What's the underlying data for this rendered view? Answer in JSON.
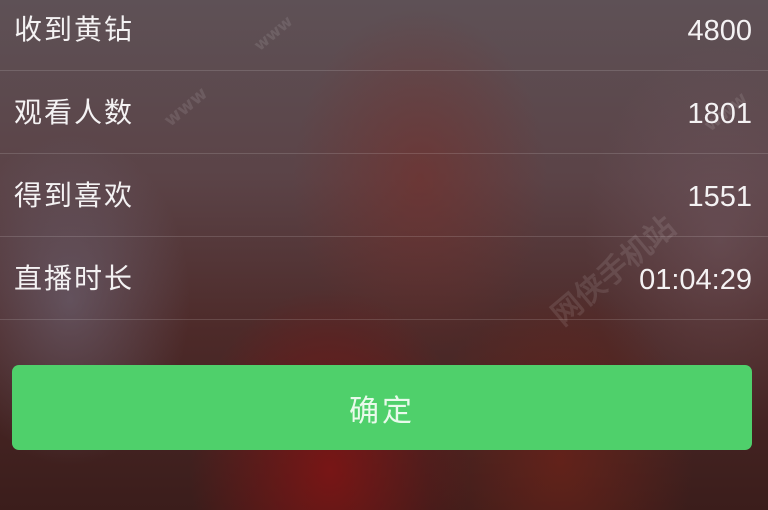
{
  "stats": {
    "rows": [
      {
        "label": "收到黄钻",
        "value": "4800"
      },
      {
        "label": "观看人数",
        "value": "1801"
      },
      {
        "label": "得到喜欢",
        "value": "1551"
      },
      {
        "label": "直播时长",
        "value": "01:04:29"
      }
    ]
  },
  "confirm_button": {
    "label": "确定"
  },
  "watermark": {
    "text": "网侠手机站",
    "url_text": "www"
  }
}
